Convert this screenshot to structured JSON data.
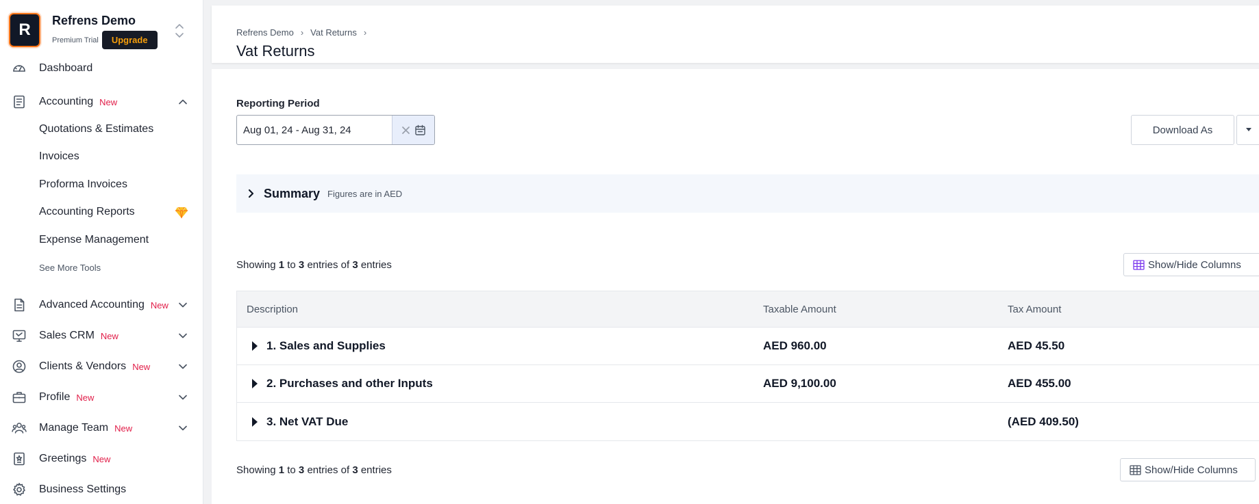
{
  "org": {
    "avatar_letter": "R",
    "name": "Refrens Demo",
    "plan": "Premium Trial",
    "upgrade_label": "Upgrade"
  },
  "sidebar": {
    "items": [
      {
        "label": "Dashboard",
        "icon": "dashboard-gauge-icon"
      },
      {
        "label": "Accounting",
        "badge": "New",
        "icon": "accounting-doc-icon",
        "expanded": true
      },
      {
        "label": "Advanced Accounting",
        "badge": "New",
        "icon": "advanced-accounting-icon"
      },
      {
        "label": "Sales CRM",
        "badge": "New",
        "icon": "crm-monitor-icon"
      },
      {
        "label": "Clients & Vendors",
        "badge": "New",
        "icon": "user-circle-icon"
      },
      {
        "label": "Profile",
        "badge": "New",
        "icon": "briefcase-icon"
      },
      {
        "label": "Manage Team",
        "badge": "New",
        "icon": "team-icon"
      },
      {
        "label": "Greetings",
        "badge": "New",
        "icon": "greetings-icon"
      },
      {
        "label": "Business Settings",
        "icon": "gear-icon"
      }
    ],
    "accounting_sub": [
      "Quotations & Estimates",
      "Invoices",
      "Proforma Invoices",
      "Accounting Reports",
      "Expense Management"
    ],
    "see_more": "See More Tools"
  },
  "header": {
    "breadcrumb": [
      "Refrens Demo",
      "Vat Returns"
    ],
    "title": "Vat Returns"
  },
  "filters": {
    "period_label": "Reporting Period",
    "period_value": "Aug 01, 24 - Aug 31, 24"
  },
  "actions": {
    "download_label": "Download As",
    "show_hide_label": "Show/Hide Columns"
  },
  "summary": {
    "title": "Summary",
    "note": "Figures are in AED"
  },
  "pagination": {
    "prefix": "Showing",
    "from": "1",
    "to_word": "to",
    "to": "3",
    "entries_word": "entries",
    "of_word": "of",
    "total": "3"
  },
  "table": {
    "columns": [
      "Description",
      "Taxable Amount",
      "Tax Amount"
    ],
    "rows": [
      {
        "description": "1. Sales and Supplies",
        "taxable": "AED 960.00",
        "tax": "AED 45.50"
      },
      {
        "description": "2. Purchases and other Inputs",
        "taxable": "AED 9,100.00",
        "tax": "AED 455.00"
      },
      {
        "description": "3. Net VAT Due",
        "taxable": "",
        "tax": "(AED 409.50)"
      }
    ]
  },
  "colors": {
    "accent_new": "#e11d48",
    "upgrade_text": "#f59e0b",
    "avatar_border": "#f97316"
  }
}
